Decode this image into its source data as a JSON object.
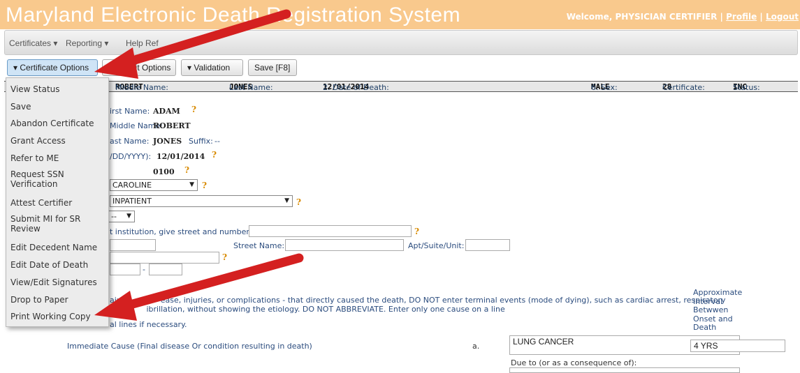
{
  "header": {
    "title": "Maryland Electronic Death Registration System",
    "welcome": "Welcome, PHYSICIAN CERTIFIER |",
    "profile": "Profile",
    "separator": "|",
    "logout": "Logout"
  },
  "menubar": {
    "certificates": "Certificates ▾",
    "reporting": "Reporting ▾",
    "help": "Help Ref"
  },
  "toolbar": {
    "certificate_options": "▾ Certificate Options",
    "permit_options": "ermit Options",
    "validation": "▾ Validation",
    "save": "Save [F8]"
  },
  "infobar": {
    "middle_label": "Middle Name:",
    "middle_value": "ROBERT",
    "last_label": "Last Name:",
    "last_value": "JONES",
    "dod_label": "2. Date of Death:",
    "dod_value": "12/01/2014",
    "sex_label": "6. Sex:",
    "sex_value": "MALE",
    "cert_label": "Certificate:",
    "cert_value": "28",
    "status_label": "Status:",
    "status_value": "INC"
  },
  "form": {
    "first_name_label": "irst Name:",
    "first_name": "ADAM",
    "middle_name_label": "Middle Name:",
    "middle_name": "ROBERT",
    "last_name_label": "ast Name:",
    "last_name": "JONES",
    "suffix_label": "Suffix:",
    "suffix_value": "--",
    "date_label": "/DD/YYYY):",
    "date_value": "12/01/2014",
    "time_value": "0100",
    "county_value": "CAROLINE",
    "place_value": "INPATIENT",
    "small_select": "--",
    "institution_label": "t institution, give street and number):",
    "street_name_label": "Street Name:",
    "apt_label": "Apt/Suite/Unit:",
    "dash": "-",
    "cause_text_line1": "ain                ease, injuries, or complications - that directly caused the death, DO NOT enter terminal events (mode of dying), such as cardiac arrest, respiratory",
    "cause_text_line2": "               ibrillation, without showing the etiology. DO NOT ABBREVIATE. Enter only one cause on a line",
    "cause_text_line3": "al lines if necessary.",
    "interval_header": [
      "Approximate",
      "Interval",
      "Betwwen",
      "Onset and",
      "Death"
    ],
    "immediate_cause_label": "Immediate Cause (Final disease Or condition resulting in death)",
    "line_a": "a.",
    "immediate_cause_value": "LUNG CANCER",
    "interval_value": "4 YRS",
    "due_to_label": "Due to (or as a consequence of):"
  },
  "dropdown": {
    "items": [
      "View Status",
      "Save",
      "Abandon Certificate",
      "Grant Access",
      "Refer to ME",
      "Request SSN Verification",
      "Attest Certifier",
      "Submit MI for SR Review",
      "Edit Decedent Name",
      "Edit Date of Death",
      "View/Edit Signatures",
      "Drop to Paper",
      "Print Working Copy"
    ]
  },
  "colors": {
    "header_bg": "#f9c98d",
    "arrow": "#d42020",
    "help_icon": "#d88a00"
  }
}
